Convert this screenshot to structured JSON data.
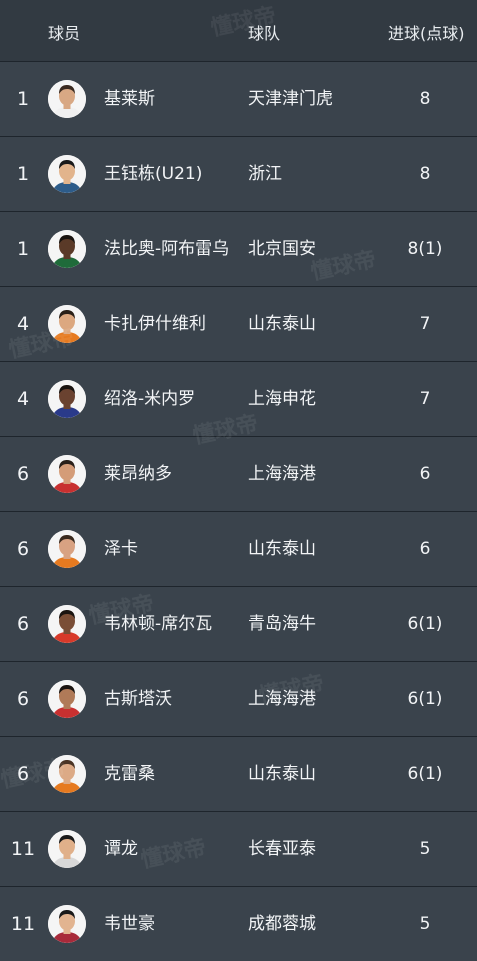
{
  "header": {
    "player_label": "球员",
    "team_label": "球队",
    "goals_label": "进球(点球)"
  },
  "watermark_text": "懂球帝",
  "rows": [
    {
      "rank": "1",
      "name": "基莱斯",
      "team": "天津津门虎",
      "goals": "8",
      "skin": "#d8a884",
      "hair": "#3a2a20",
      "shirt": "#f0f0f0"
    },
    {
      "rank": "1",
      "name": "王钰栋(U21)",
      "team": "浙江",
      "goals": "8",
      "skin": "#e2b48c",
      "hair": "#1a1a1a",
      "shirt": "#2d5c8a"
    },
    {
      "rank": "1",
      "name": "法比奥-阿布雷乌",
      "team": "北京国安",
      "goals": "8(1)",
      "skin": "#5a3a28",
      "hair": "#1a1410",
      "shirt": "#1f6b3a"
    },
    {
      "rank": "4",
      "name": "卡扎伊什维利",
      "team": "山东泰山",
      "goals": "7",
      "skin": "#dca880",
      "hair": "#2a2018",
      "shirt": "#e67a20"
    },
    {
      "rank": "4",
      "name": "绍洛-米内罗",
      "team": "上海申花",
      "goals": "7",
      "skin": "#6a4230",
      "hair": "#1a1410",
      "shirt": "#2a3a8a"
    },
    {
      "rank": "6",
      "name": "莱昂纳多",
      "team": "上海海港",
      "goals": "6",
      "skin": "#d49c78",
      "hair": "#2a201a",
      "shirt": "#c83030"
    },
    {
      "rank": "6",
      "name": "泽卡",
      "team": "山东泰山",
      "goals": "6",
      "skin": "#d8a282",
      "hair": "#3a2a1e",
      "shirt": "#e67a20"
    },
    {
      "rank": "6",
      "name": "韦林顿-席尔瓦",
      "team": "青岛海牛",
      "goals": "6(1)",
      "skin": "#7a4e36",
      "hair": "#1a1410",
      "shirt": "#d83a2a"
    },
    {
      "rank": "6",
      "name": "古斯塔沃",
      "team": "上海海港",
      "goals": "6(1)",
      "skin": "#b07a58",
      "hair": "#1a1410",
      "shirt": "#c83030"
    },
    {
      "rank": "6",
      "name": "克雷桑",
      "team": "山东泰山",
      "goals": "6(1)",
      "skin": "#dcaa86",
      "hair": "#4a3424",
      "shirt": "#e67a20"
    },
    {
      "rank": "11",
      "name": "谭龙",
      "team": "长春亚泰",
      "goals": "5",
      "skin": "#e0b08a",
      "hair": "#1a1a1a",
      "shirt": "#d8d8d8"
    },
    {
      "rank": "11",
      "name": "韦世豪",
      "team": "成都蓉城",
      "goals": "5",
      "skin": "#e2b490",
      "hair": "#1a1a1a",
      "shirt": "#a82a3a"
    }
  ]
}
